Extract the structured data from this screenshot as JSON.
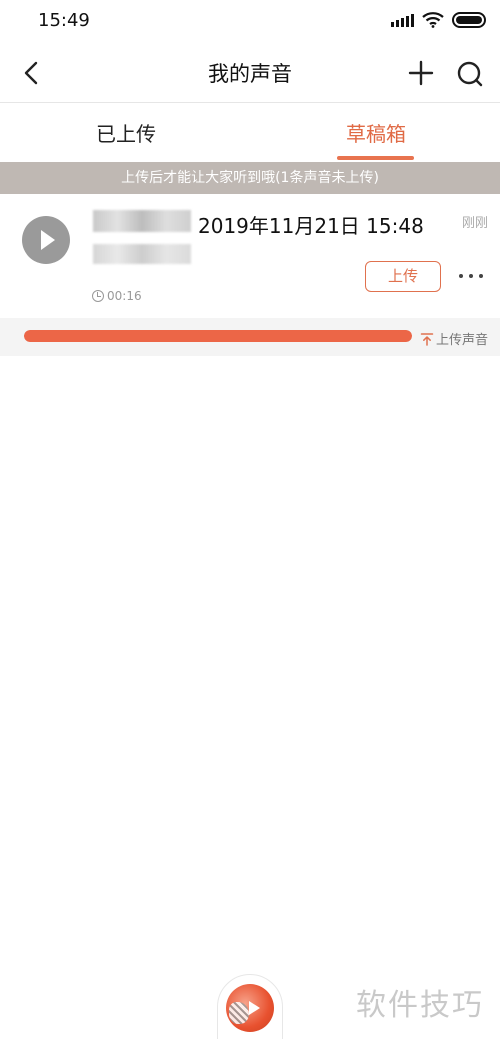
{
  "status_bar": {
    "time": "15:49"
  },
  "header": {
    "title": "我的声音"
  },
  "tabs": [
    {
      "label": "已上传",
      "active": false
    },
    {
      "label": "草稿箱",
      "active": true
    }
  ],
  "notice": "上传后才能让大家听到哦(1条声音未上传)",
  "draft": {
    "title": "2019年11月21日 15:48",
    "time_ago": "刚刚",
    "duration": "00:16",
    "upload_label": "上传"
  },
  "progress": {
    "value": 1.0,
    "upload_all_label": "上传声音"
  },
  "watermark": "软件技巧",
  "colors": {
    "accent": "#e0714e",
    "progress": "#ec6647",
    "banner": "#bfb8b3"
  }
}
